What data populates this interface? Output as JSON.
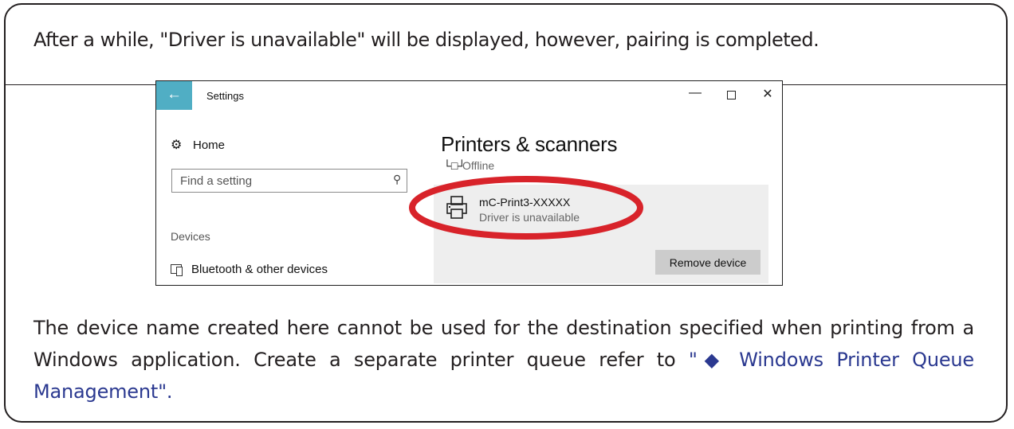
{
  "instruction": {
    "intro": "After a while, \"Driver is unavailable\" will be displayed, however, pairing is completed.",
    "note_prefix": "The device name created here cannot be used for the destination specified when printing from a Windows application. Create a separate printer queue refer to ",
    "note_link": "\"◆ Windows Printer Queue Management\".",
    "colors": {
      "link": "#2b3990",
      "highlight": "#d8232a",
      "accent": "#50aec4"
    }
  },
  "window": {
    "back_icon": "←",
    "title": "Settings",
    "controls": {
      "minimize": "—",
      "close": "✕"
    },
    "sidebar": {
      "home_label": "Home",
      "search_placeholder": "Find a setting",
      "section_label": "Devices",
      "nav_item": "Bluetooth & other devices"
    },
    "main": {
      "heading": "Printers & scanners",
      "offline_status": "Offline",
      "selected_printer": {
        "name": "mC-Print3-XXXXX",
        "status": "Driver is unavailable",
        "remove_button": "Remove device"
      }
    }
  }
}
